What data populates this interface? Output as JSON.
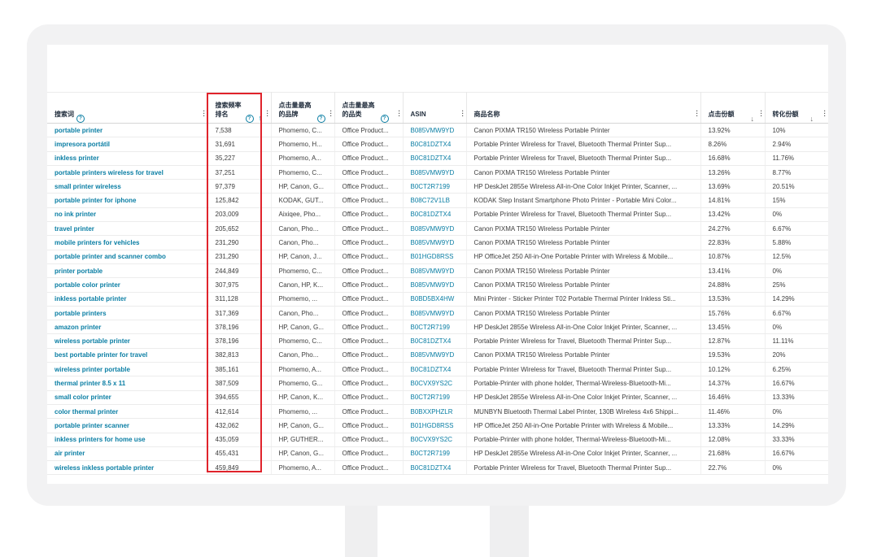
{
  "table": {
    "columns": [
      {
        "label": "搜索词",
        "help": true,
        "sort": ""
      },
      {
        "label": "搜索频率排名",
        "help": true,
        "sort": "↑"
      },
      {
        "label": "点击量最高的品牌",
        "help": true,
        "sort": ""
      },
      {
        "label": "点击量最高的品类",
        "help": true,
        "sort": ""
      },
      {
        "label": "ASIN",
        "help": false,
        "sort": ""
      },
      {
        "label": "商品名称",
        "help": false,
        "sort": ""
      },
      {
        "label": "点击份额",
        "help": false,
        "sort": "↓"
      },
      {
        "label": "转化份额",
        "help": false,
        "sort": "↓"
      }
    ],
    "rows": [
      {
        "term": "portable printer",
        "rank": "7,538",
        "brand": "Phomemo, C...",
        "category": "Office Product...",
        "asin": "B085VMW9YD",
        "title": "Canon PIXMA TR150 Wireless Portable Printer",
        "click_share": "13.92%",
        "conv_share": "10%"
      },
      {
        "term": "impresora portátil",
        "rank": "31,691",
        "brand": "Phomemo, H...",
        "category": "Office Product...",
        "asin": "B0C81DZTX4",
        "title": "Portable Printer Wireless for Travel, Bluetooth Thermal Printer Sup...",
        "click_share": "8.26%",
        "conv_share": "2.94%"
      },
      {
        "term": "inkless printer",
        "rank": "35,227",
        "brand": "Phomemo, A...",
        "category": "Office Product...",
        "asin": "B0C81DZTX4",
        "title": "Portable Printer Wireless for Travel, Bluetooth Thermal Printer Sup...",
        "click_share": "16.68%",
        "conv_share": "11.76%"
      },
      {
        "term": "portable printers wireless for travel",
        "rank": "37,251",
        "brand": "Phomemo, C...",
        "category": "Office Product...",
        "asin": "B085VMW9YD",
        "title": "Canon PIXMA TR150 Wireless Portable Printer",
        "click_share": "13.26%",
        "conv_share": "8.77%"
      },
      {
        "term": "small printer wireless",
        "rank": "97,379",
        "brand": "HP, Canon, G...",
        "category": "Office Product...",
        "asin": "B0CT2R7199",
        "title": "HP DeskJet 2855e Wireless All-in-One Color Inkjet Printer, Scanner, ...",
        "click_share": "13.69%",
        "conv_share": "20.51%"
      },
      {
        "term": "portable printer for iphone",
        "rank": "125,842",
        "brand": "KODAK, GUT...",
        "category": "Office Product...",
        "asin": "B08C72V1LB",
        "title": "KODAK Step Instant Smartphone Photo Printer - Portable Mini Color...",
        "click_share": "14.81%",
        "conv_share": "15%"
      },
      {
        "term": "no ink printer",
        "rank": "203,009",
        "brand": "Aixiqee, Pho...",
        "category": "Office Product...",
        "asin": "B0C81DZTX4",
        "title": "Portable Printer Wireless for Travel, Bluetooth Thermal Printer Sup...",
        "click_share": "13.42%",
        "conv_share": "0%"
      },
      {
        "term": "travel printer",
        "rank": "205,652",
        "brand": "Canon, Pho...",
        "category": "Office Product...",
        "asin": "B085VMW9YD",
        "title": "Canon PIXMA TR150 Wireless Portable Printer",
        "click_share": "24.27%",
        "conv_share": "6.67%"
      },
      {
        "term": "mobile printers for vehicles",
        "rank": "231,290",
        "brand": "Canon, Pho...",
        "category": "Office Product...",
        "asin": "B085VMW9YD",
        "title": "Canon PIXMA TR150 Wireless Portable Printer",
        "click_share": "22.83%",
        "conv_share": "5.88%"
      },
      {
        "term": "portable printer and scanner combo",
        "rank": "231,290",
        "brand": "HP, Canon, J...",
        "category": "Office Product...",
        "asin": "B01HGD8RSS",
        "title": "HP OfficeJet 250 All-in-One Portable Printer with Wireless & Mobile...",
        "click_share": "10.87%",
        "conv_share": "12.5%"
      },
      {
        "term": "printer portable",
        "rank": "244,849",
        "brand": "Phomemo, C...",
        "category": "Office Product...",
        "asin": "B085VMW9YD",
        "title": "Canon PIXMA TR150 Wireless Portable Printer",
        "click_share": "13.41%",
        "conv_share": "0%"
      },
      {
        "term": "portable color printer",
        "rank": "307,975",
        "brand": "Canon, HP, K...",
        "category": "Office Product...",
        "asin": "B085VMW9YD",
        "title": "Canon PIXMA TR150 Wireless Portable Printer",
        "click_share": "24.88%",
        "conv_share": "25%"
      },
      {
        "term": "inkless portable printer",
        "rank": "311,128",
        "brand": "Phomemo, ...",
        "category": "Office Product...",
        "asin": "B0BD5BX4HW",
        "title": "Mini Printer - Sticker Printer T02 Portable Thermal Printer Inkless Sti...",
        "click_share": "13.53%",
        "conv_share": "14.29%"
      },
      {
        "term": "portable printers",
        "rank": "317,369",
        "brand": "Canon, Pho...",
        "category": "Office Product...",
        "asin": "B085VMW9YD",
        "title": "Canon PIXMA TR150 Wireless Portable Printer",
        "click_share": "15.76%",
        "conv_share": "6.67%"
      },
      {
        "term": "amazon printer",
        "rank": "378,196",
        "brand": "HP, Canon, G...",
        "category": "Office Product...",
        "asin": "B0CT2R7199",
        "title": "HP DeskJet 2855e Wireless All-in-One Color Inkjet Printer, Scanner, ...",
        "click_share": "13.45%",
        "conv_share": "0%"
      },
      {
        "term": "wireless portable printer",
        "rank": "378,196",
        "brand": "Phomemo, C...",
        "category": "Office Product...",
        "asin": "B0C81DZTX4",
        "title": "Portable Printer Wireless for Travel, Bluetooth Thermal Printer Sup...",
        "click_share": "12.87%",
        "conv_share": "11.11%"
      },
      {
        "term": "best portable printer for travel",
        "rank": "382,813",
        "brand": "Canon, Pho...",
        "category": "Office Product...",
        "asin": "B085VMW9YD",
        "title": "Canon PIXMA TR150 Wireless Portable Printer",
        "click_share": "19.53%",
        "conv_share": "20%"
      },
      {
        "term": "wireless printer portable",
        "rank": "385,161",
        "brand": "Phomemo, A...",
        "category": "Office Product...",
        "asin": "B0C81DZTX4",
        "title": "Portable Printer Wireless for Travel, Bluetooth Thermal Printer Sup...",
        "click_share": "10.12%",
        "conv_share": "6.25%"
      },
      {
        "term": "thermal printer 8.5 x 11",
        "rank": "387,509",
        "brand": "Phomemo, G...",
        "category": "Office Product...",
        "asin": "B0CVX9YS2C",
        "title": "Portable-Printer with phone holder, Thermal-Wireless-Bluetooth-Mi...",
        "click_share": "14.37%",
        "conv_share": "16.67%"
      },
      {
        "term": "small color printer",
        "rank": "394,655",
        "brand": "HP, Canon, K...",
        "category": "Office Product...",
        "asin": "B0CT2R7199",
        "title": "HP DeskJet 2855e Wireless All-in-One Color Inkjet Printer, Scanner, ...",
        "click_share": "16.46%",
        "conv_share": "13.33%"
      },
      {
        "term": "color thermal printer",
        "rank": "412,614",
        "brand": "Phomemo, ...",
        "category": "Office Product...",
        "asin": "B0BXXPHZLR",
        "title": "MUNBYN Bluetooth Thermal Label Printer, 130B Wireless 4x6 Shippi...",
        "click_share": "11.46%",
        "conv_share": "0%"
      },
      {
        "term": "portable printer scanner",
        "rank": "432,062",
        "brand": "HP, Canon, G...",
        "category": "Office Product...",
        "asin": "B01HGD8RSS",
        "title": "HP OfficeJet 250 All-in-One Portable Printer with Wireless & Mobile...",
        "click_share": "13.33%",
        "conv_share": "14.29%"
      },
      {
        "term": "inkless printers for home use",
        "rank": "435,059",
        "brand": "HP, GUTHER...",
        "category": "Office Product...",
        "asin": "B0CVX9YS2C",
        "title": "Portable-Printer with phone holder, Thermal-Wireless-Bluetooth-Mi...",
        "click_share": "12.08%",
        "conv_share": "33.33%"
      },
      {
        "term": "air printer",
        "rank": "455,431",
        "brand": "HP, Canon, G...",
        "category": "Office Product...",
        "asin": "B0CT2R7199",
        "title": "HP DeskJet 2855e Wireless All-in-One Color Inkjet Printer, Scanner, ...",
        "click_share": "21.68%",
        "conv_share": "16.67%"
      },
      {
        "term": "wireless inkless portable printer",
        "rank": "459,849",
        "brand": "Phomemo, A...",
        "category": "Office Product...",
        "asin": "B0C81DZTX4",
        "title": "Portable Printer Wireless for Travel, Bluetooth Thermal Printer Sup...",
        "click_share": "22.7%",
        "conv_share": "0%"
      }
    ]
  },
  "icons": {
    "help": "help-circle-icon",
    "column_menu": "vertical-dots-icon",
    "sort_ascending": "arrow-up-icon",
    "sort_descending": "arrow-down-icon"
  },
  "colors": {
    "link": "#0a7ea4",
    "highlight_border": "#e0232b"
  }
}
